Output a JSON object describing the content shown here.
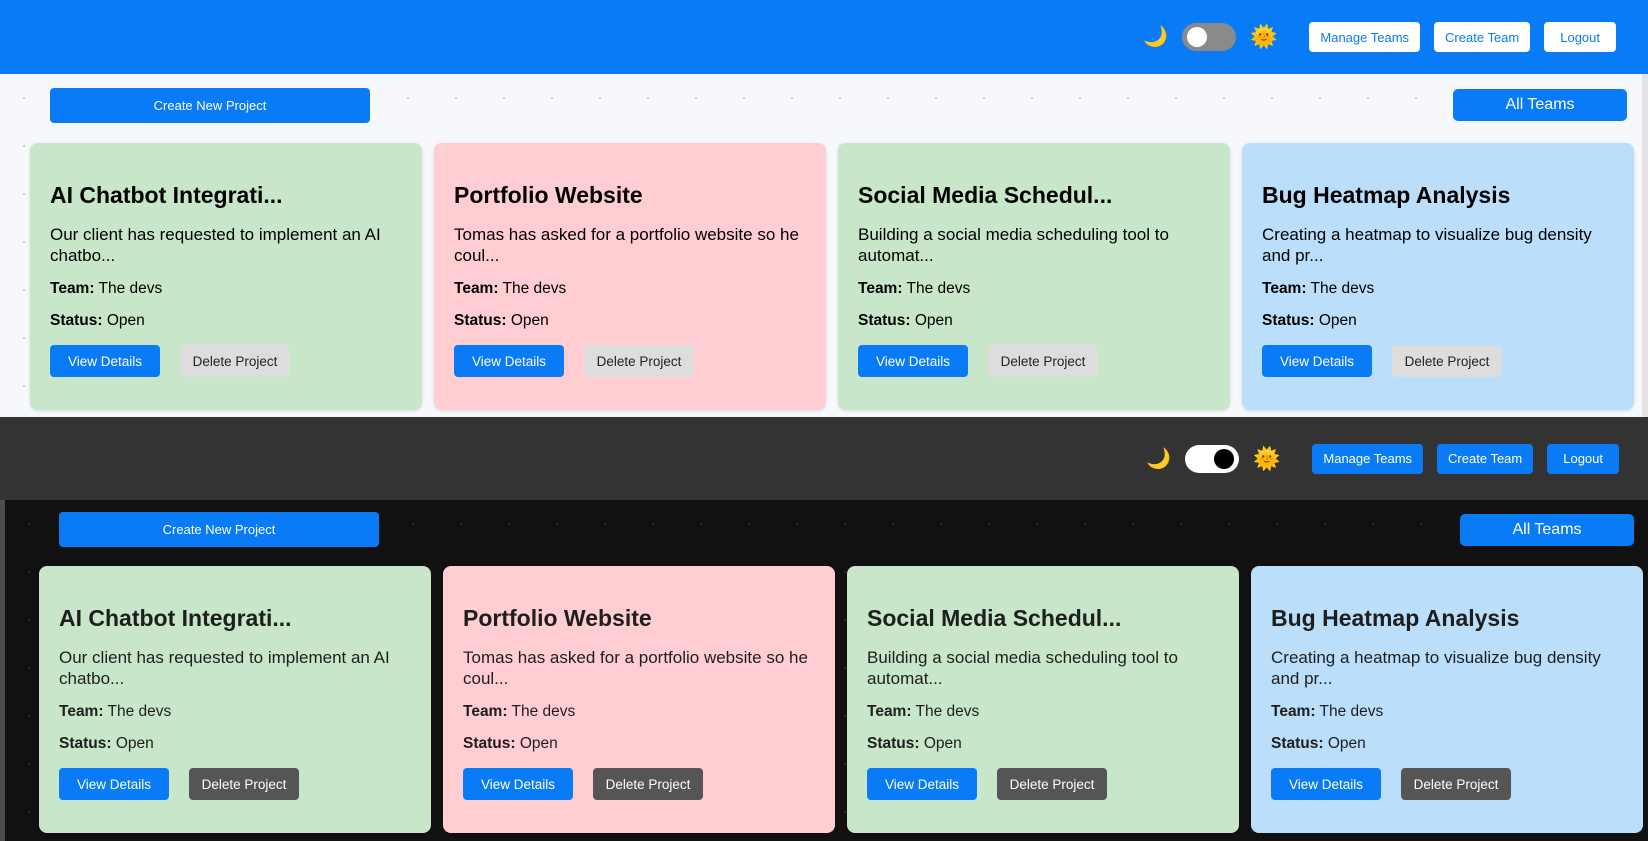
{
  "theme_icons": {
    "moon": "🌙",
    "sun": "🌞"
  },
  "nav": {
    "manage_teams": "Manage Teams",
    "create_team": "Create Team",
    "logout": "Logout"
  },
  "toolbar": {
    "create_project": "Create New Project",
    "team_filter": "All Teams"
  },
  "labels": {
    "team": "Team:",
    "status": "Status:",
    "view_details": "View Details",
    "delete_project": "Delete Project"
  },
  "projects": [
    {
      "title": "AI Chatbot Integrati...",
      "description": "Our client has requested to implement an AI chatbo...",
      "team": "The devs",
      "status": "Open",
      "color": "#c8e6c9"
    },
    {
      "title": "Portfolio Website",
      "description": "Tomas has asked for a portfolio website so he coul...",
      "team": "The devs",
      "status": "Open",
      "color": "#ffcdd2"
    },
    {
      "title": "Social Media Schedul...",
      "description": "Building a social media scheduling tool to automat...",
      "team": "The devs",
      "status": "Open",
      "color": "#c8e6c9"
    },
    {
      "title": "Bug Heatmap Analysis",
      "description": "Creating a heatmap to visualize bug density and pr...",
      "team": "The devs",
      "status": "Open",
      "color": "#bbdefb"
    }
  ],
  "colors": {
    "primary": "#0a7bf7",
    "light_header": "#0a7bf7",
    "dark_header": "#333333",
    "dark_background": "#111111"
  }
}
